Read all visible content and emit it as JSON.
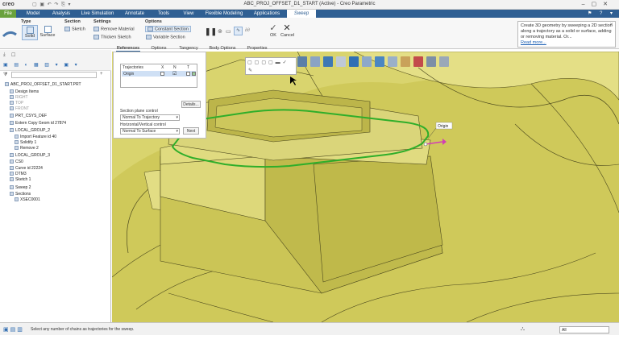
{
  "app": {
    "logo": "creo",
    "title": "ABC_PROJ_OFFSET_D1_START (Active) - Creo Parametric"
  },
  "tabs": [
    {
      "label": "File"
    },
    {
      "label": "Model"
    },
    {
      "label": "Analysis"
    },
    {
      "label": "Live Simulation"
    },
    {
      "label": "Annotate"
    },
    {
      "label": "Tools"
    },
    {
      "label": "View"
    },
    {
      "label": "Flexible Modeling"
    },
    {
      "label": "Applications"
    },
    {
      "label": "Sweep"
    }
  ],
  "ribbon": {
    "type_title": "Type",
    "solid_label": "Solid",
    "surface_label": "Surface",
    "section_title": "Section",
    "sketch_label": "Sketch",
    "settings_title": "Settings",
    "remove_material_label": "Remove Material",
    "thicken_sketch_label": "Thicken Sketch",
    "options_title": "Options",
    "constant_section_label": "Constant Section",
    "variable_section_label": "Variable Section",
    "ok_label": "OK",
    "cancel_label": "Cancel"
  },
  "help": {
    "text": "Create 3D geometry by sweeping a 2D section along a trajectory as a solid or surface, adding or removing material. Or...",
    "more": "Read more..."
  },
  "subtabs": [
    {
      "label": "References"
    },
    {
      "label": "Options"
    },
    {
      "label": "Tangency"
    },
    {
      "label": "Body Options"
    },
    {
      "label": "Properties"
    }
  ],
  "references_panel": {
    "col_trajectories": "Trajectories",
    "col_x": "X",
    "col_n": "N",
    "col_t": "T",
    "row_origin": "Origin",
    "details_label": "Details...",
    "section_plane_label": "Section plane control",
    "section_plane_value": "Normal To Trajectory",
    "orientation_label": "Horizontal/Vertical control",
    "orientation_value": "Normal To Surface",
    "next_label": "Next"
  },
  "tree": {
    "search_placeholder": "",
    "items": [
      {
        "label": "ABC_PROJ_OFFSET_D1_START.PRT",
        "grey": false,
        "indent": 0
      },
      {
        "label": "Design Items",
        "grey": false,
        "indent": 1
      },
      {
        "label": "RIGHT",
        "grey": true,
        "indent": 1
      },
      {
        "label": "TOP",
        "grey": true,
        "indent": 1
      },
      {
        "label": "FRONT",
        "grey": true,
        "indent": 1
      },
      {
        "label": "PRT_CSYS_DEF",
        "grey": false,
        "indent": 1
      },
      {
        "label": "Extern Copy Geom id 27874",
        "grey": false,
        "indent": 1
      },
      {
        "label": "LOCAL_GROUP_2",
        "grey": false,
        "indent": 1
      },
      {
        "label": "Import Feature id 40",
        "grey": false,
        "indent": 2
      },
      {
        "label": "Solidify 1",
        "grey": false,
        "indent": 2
      },
      {
        "label": "Remove 2",
        "grey": false,
        "indent": 2
      },
      {
        "label": "LOCAL_GROUP_3",
        "grey": false,
        "indent": 1
      },
      {
        "label": "CS0",
        "grey": false,
        "indent": 1
      },
      {
        "label": "Curve id 22224",
        "grey": false,
        "indent": 1
      },
      {
        "label": "DTM3",
        "grey": false,
        "indent": 1
      },
      {
        "label": "Sketch 1",
        "grey": false,
        "indent": 1
      },
      {
        "label": "Sweep 2",
        "grey": false,
        "indent": 1
      },
      {
        "label": "Sections",
        "grey": false,
        "indent": 1
      },
      {
        "label": "XSEC0001",
        "grey": false,
        "indent": 2
      }
    ]
  },
  "viewport": {
    "origin_label": "Origin"
  },
  "status": {
    "message": "Select any number of chains as trajectories for the sweep.",
    "filter_value": "All"
  }
}
